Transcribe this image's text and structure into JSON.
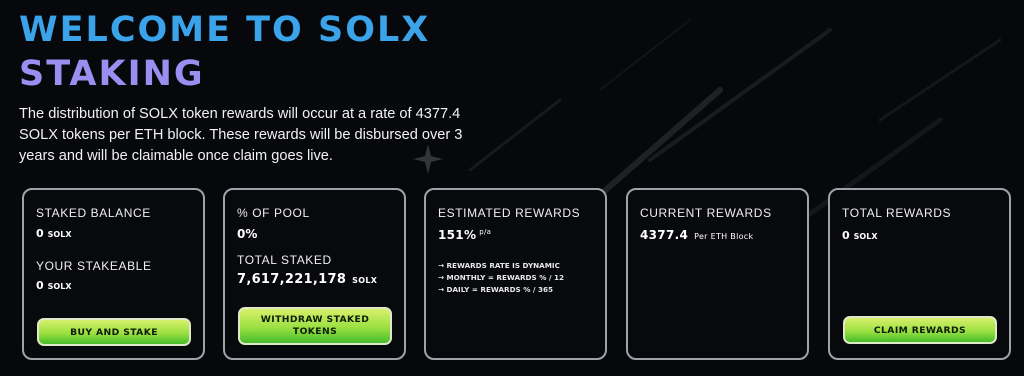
{
  "hero": {
    "title_line1": "WELCOME TO SOLX",
    "title_line2": "STAKING",
    "description": "The distribution of SOLX token rewards will occur at a rate of 4377.4 SOLX tokens per ETH block. These rewards will be disbursed over 3 years and will be claimable once claim goes live."
  },
  "cards": {
    "balance": {
      "staked_label": "STAKED BALANCE",
      "staked_value": "0",
      "staked_unit": "SOLX",
      "stakeable_label": "YOUR STAKEABLE",
      "stakeable_value": "0",
      "stakeable_unit": "SOLX",
      "button": "BUY AND STAKE"
    },
    "pool": {
      "pool_label": "% OF POOL",
      "pool_value": "0%",
      "total_label": "TOTAL STAKED",
      "total_value": "7,617,221,178",
      "total_unit": "SOLX",
      "button": "WITHDRAW STAKED TOKENS"
    },
    "estimated": {
      "label": "ESTIMATED REWARDS",
      "value": "151%",
      "suffix": "p/a",
      "notes": [
        "→ REWARDS RATE IS DYNAMIC",
        "→ MONTHLY = REWARDS % / 12",
        "→ DAILY = REWARDS % / 365"
      ]
    },
    "current": {
      "label": "CURRENT REWARDS",
      "value": "4377.4",
      "unit": "Per ETH Block"
    },
    "total": {
      "label": "TOTAL REWARDS",
      "value": "0",
      "unit": "SOLX",
      "button": "CLAIM REWARDS"
    }
  },
  "colors": {
    "background": "#07080b",
    "title_blue": "#3aa3ea",
    "title_purple": "#9b8ef1",
    "card_border": "#9ea3aa",
    "button_green": "#9be042"
  }
}
